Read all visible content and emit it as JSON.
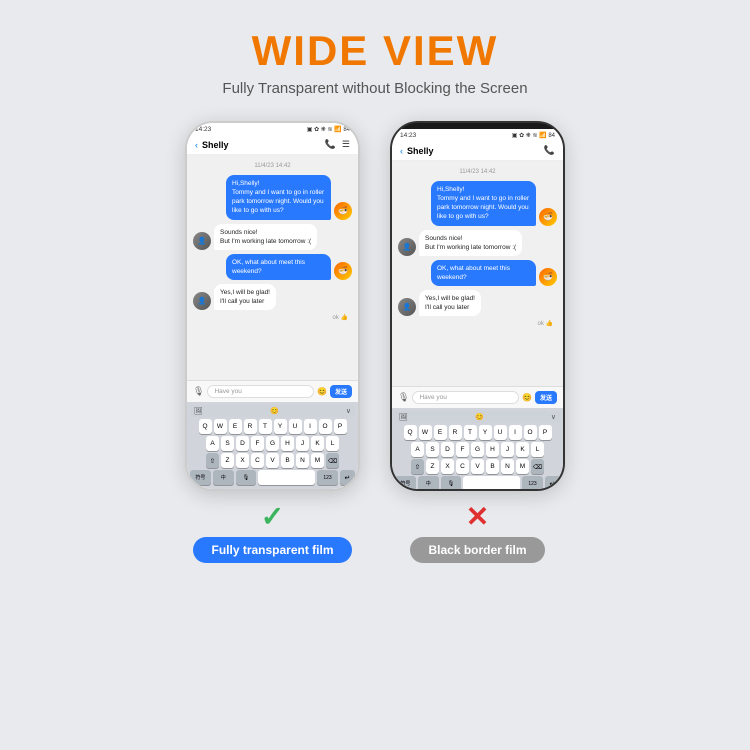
{
  "header": {
    "title": "WIDE VIEW",
    "subtitle": "Fully Transparent without Blocking the Screen"
  },
  "phone_left": {
    "status": {
      "time": "14:23",
      "icons": "📶"
    },
    "chat_header": {
      "back": "‹",
      "name": "Shelly",
      "icons": [
        "📞",
        "☰"
      ]
    },
    "date_label": "11/4/23 14:42",
    "messages": [
      {
        "type": "sent",
        "text": "Hi,Shelly!\nTommy and I want to go in roller park tomorrow night. Would you like to go with us?",
        "avatar": "food"
      },
      {
        "type": "received",
        "text": "Sounds nice!\nBut I'm working late tomorrow :(",
        "avatar": "person"
      },
      {
        "type": "sent",
        "text": "OK, what about meet this weekend?",
        "avatar": "food"
      },
      {
        "type": "received",
        "text": "Yes,I will be glad!\nI'll call you later",
        "avatar": "person"
      }
    ],
    "ok_label": "ok",
    "input_placeholder": "Have you",
    "send_label": "发送",
    "keyboard_rows": [
      [
        "Q",
        "W",
        "E",
        "R",
        "T",
        "Y",
        "U",
        "I",
        "O",
        "P"
      ],
      [
        "A",
        "S",
        "D",
        "F",
        "G",
        "H",
        "J",
        "K",
        "L"
      ],
      [
        "Z",
        "X",
        "C",
        "V",
        "B",
        "N",
        "M"
      ]
    ],
    "bottom_keys": [
      "符号",
      "中",
      "mic",
      "123",
      "enter"
    ]
  },
  "phone_right": {
    "type": "dark"
  },
  "label_left": {
    "check": "✓",
    "text": "Fully transparent film"
  },
  "label_right": {
    "cross": "✕",
    "text": "Black border film"
  }
}
